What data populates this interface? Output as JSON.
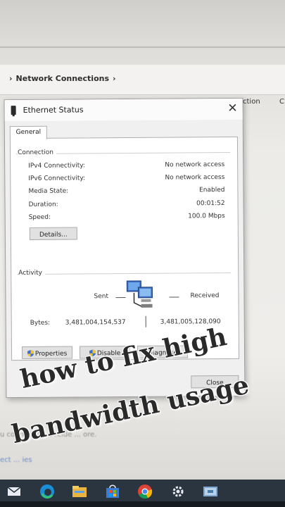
{
  "explorer": {
    "breadcrumb_sep": "›",
    "breadcrumb": "Network Connections",
    "breadcrumb_end": "›",
    "column_header": "ction",
    "column_header_c": "C",
    "blurred_text": "u connect to, decide ... ore.",
    "blurred_link": "ect ... ies"
  },
  "dialog": {
    "title": "Ethernet Status",
    "close_glyph": "✕",
    "tab": "General",
    "connection": {
      "heading": "Connection",
      "rows": [
        {
          "label": "IPv4 Connectivity:",
          "value": "No network access"
        },
        {
          "label": "IPv6 Connectivity:",
          "value": "No network access"
        },
        {
          "label": "Media State:",
          "value": "Enabled"
        },
        {
          "label": "Duration:",
          "value": "00:01:52"
        },
        {
          "label": "Speed:",
          "value": "100.0 Mbps"
        }
      ],
      "details_button": "Details..."
    },
    "activity": {
      "heading": "Activity",
      "sent_label": "Sent",
      "received_label": "Received",
      "bytes_label": "Bytes:",
      "bytes_sent": "3,481,004,154,537",
      "bytes_received": "3,481,005,128,090",
      "network_icon": "network-computers-icon"
    },
    "buttons": {
      "properties": "Properties",
      "disable": "Disable",
      "diagnose": "Diagnose",
      "close": "Close"
    }
  },
  "overlay": {
    "line1": "how to fix high",
    "line2": "bandwidth usage"
  },
  "taskbar": {
    "icons": [
      "mail-icon",
      "edge-icon",
      "file-explorer-icon",
      "store-icon",
      "chrome-icon",
      "settings-icon",
      "network-app-icon"
    ]
  },
  "colors": {
    "dialog_bg": "#f0f0f0",
    "panel_bg": "#ffffff",
    "taskbar_bg": "#2b3540",
    "caption_text": "#2a2a2a"
  }
}
